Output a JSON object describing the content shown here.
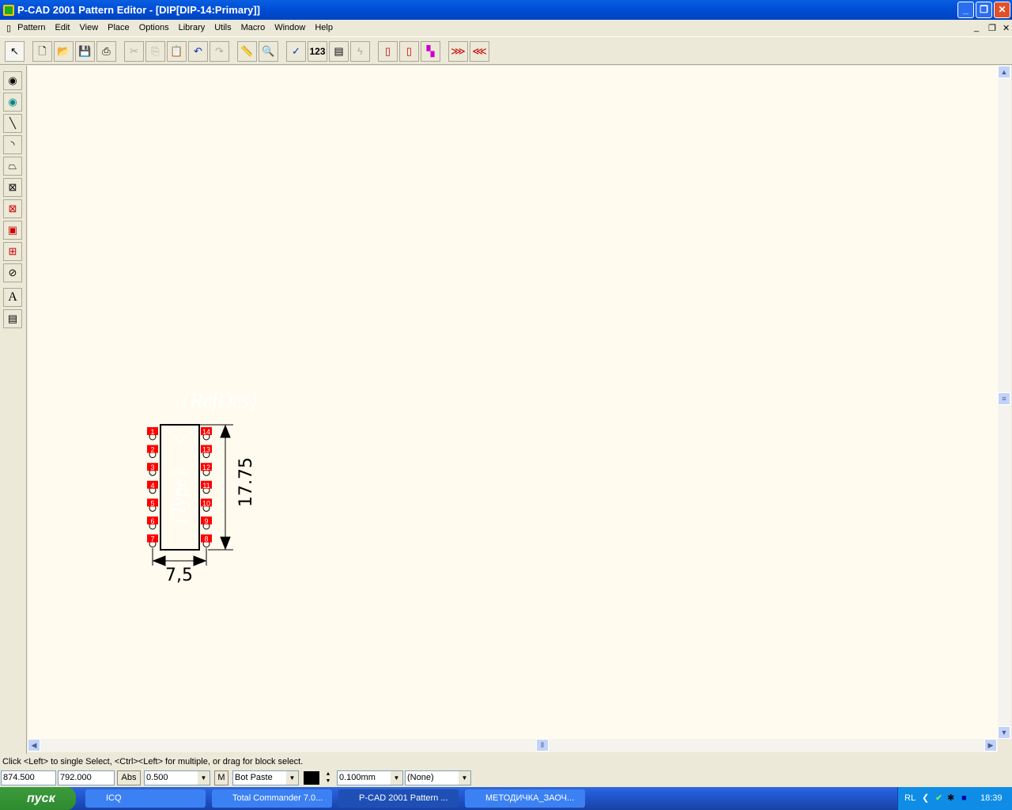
{
  "window": {
    "title": "P-CAD 2001 Pattern Editor - [DIP[DIP-14:Primary]]"
  },
  "menu": [
    "Pattern",
    "Edit",
    "View",
    "Place",
    "Options",
    "Library",
    "Utils",
    "Macro",
    "Window",
    "Help"
  ],
  "toolbar": {
    "pad_numbering_label": "123"
  },
  "left_tools": {
    "text_tool": "A"
  },
  "pattern": {
    "refdes": "{RefDes}",
    "type": "{Type}",
    "width_dim": "7,5",
    "height_dim": "17.75",
    "left_pads": [
      "1",
      "2",
      "3",
      "4",
      "5",
      "6",
      "7"
    ],
    "right_pads": [
      "14",
      "13",
      "12",
      "11",
      "10",
      "9",
      "8"
    ],
    "pad_color": "#ff0000",
    "canvas_color": "#fffbee"
  },
  "status": {
    "message": "Click <Left> to single Select, <Ctrl><Left> for multiple, or drag for block select."
  },
  "bottom": {
    "x": "874.500",
    "y": "792.000",
    "abs_label": "Abs",
    "grid": "0.500",
    "m_label": "M",
    "layer": "Bot Paste",
    "line_width": "0.100mm",
    "net": "(None)"
  },
  "taskbar": {
    "start": "пуск",
    "tasks": [
      "ICQ",
      "Total Commander 7.0...",
      "P-CAD 2001 Pattern ...",
      "МЕТОДИЧКА_ЗАОЧ..."
    ],
    "lang": "RL",
    "clock": "18:39"
  }
}
